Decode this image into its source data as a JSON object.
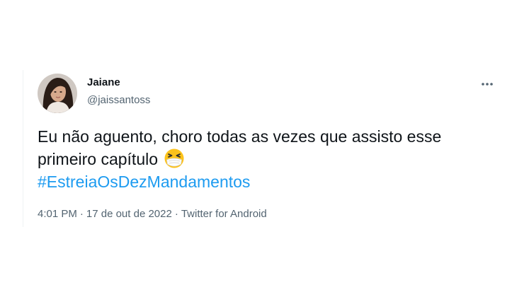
{
  "tweet": {
    "author": {
      "display_name": "Jaiane",
      "handle": "@jaissantoss",
      "avatar_icon": "profile-photo"
    },
    "more_icon": "more-horizontal-icon",
    "text_line1": "Eu não aguento, choro todas as vezes que assisto esse",
    "text_line2": "primeiro capítulo",
    "emoji": "face-with-medical-mask-squinting-emoji",
    "hashtag": "#EstreiaOsDezMandamentos",
    "time": "4:01 PM",
    "separator": "·",
    "date": "17 de out de 2022",
    "source": "Twitter for Android",
    "colors": {
      "link": "#1d9bf0",
      "secondary_text": "#536471",
      "primary_text": "#0f1419"
    }
  }
}
